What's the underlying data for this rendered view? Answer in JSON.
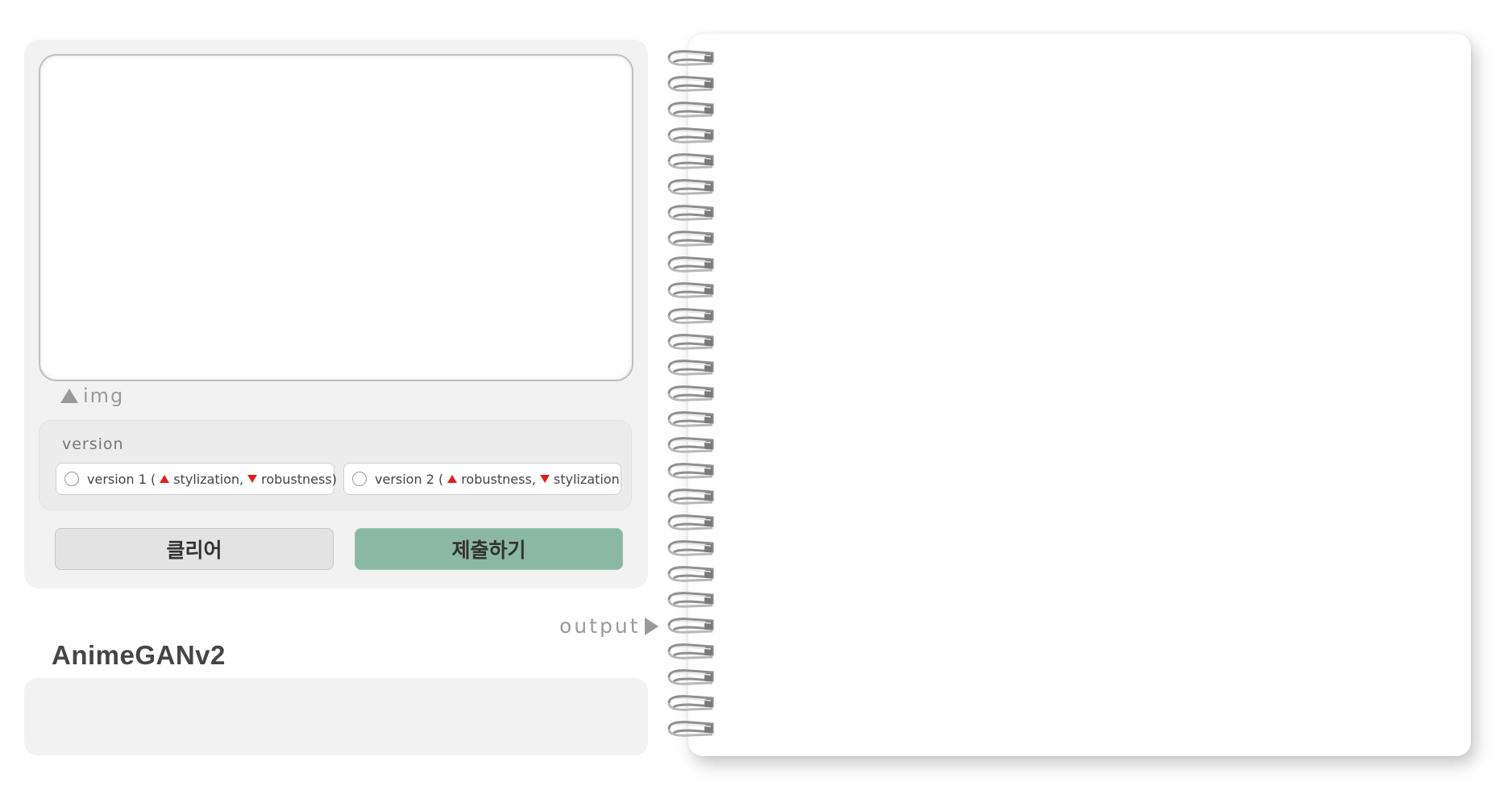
{
  "app": {
    "title": "AnimeGANv2"
  },
  "input": {
    "image_label": "img"
  },
  "version": {
    "title": "version",
    "options": [
      {
        "prefix": "version 1 (",
        "up_label": "stylization,",
        "down_label": "robustness)",
        "selected": false
      },
      {
        "prefix": "version 2 (",
        "up_label": "robustness,",
        "down_label": "stylization",
        "selected": false
      }
    ]
  },
  "buttons": {
    "clear_label": "클리어",
    "submit_label": "제출하기"
  },
  "output": {
    "label": "output"
  },
  "colors": {
    "panel_bg": "#f2f2f2",
    "submit_bg": "#8bb8a2",
    "clear_bg": "#e3e3e3",
    "arrow_up": "#e02020",
    "arrow_down": "#e02020"
  }
}
